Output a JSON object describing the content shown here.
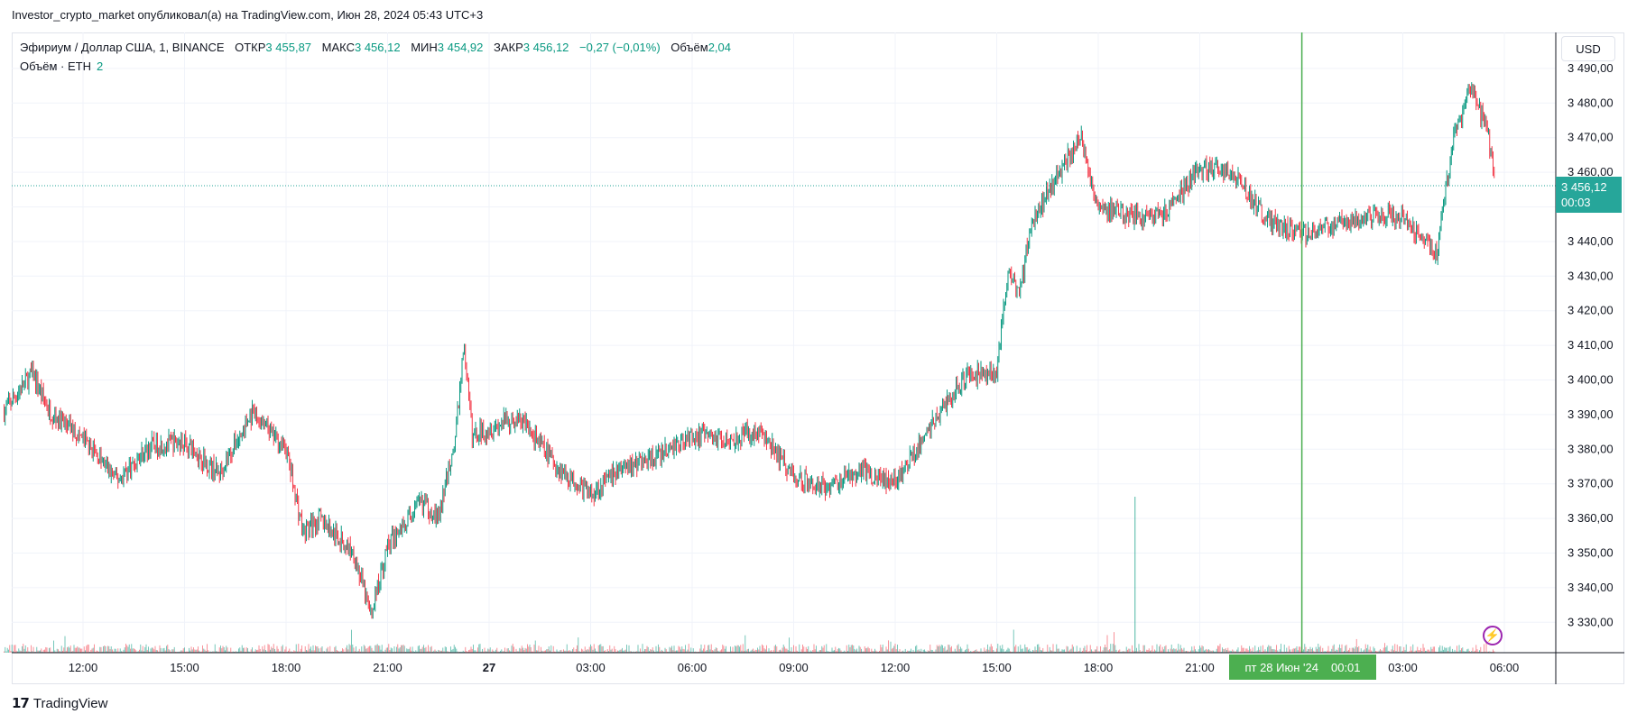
{
  "header": {
    "published_line": "Investor_crypto_market опубликовал(а) на TradingView.com, Июн 28, 2024 05:43 UTC+3"
  },
  "legend": {
    "symbol": "Эфириум / Доллар США, 1, BINANCE",
    "open_label": "ОТКР",
    "open_value": "3 455,87",
    "high_label": "МАКС",
    "high_value": "3 456,12",
    "low_label": "МИН",
    "low_value": "3 454,92",
    "close_label": "ЗАКР",
    "close_value": "3 456,12",
    "change": "−0,27 (−0,01%)",
    "volume_label": "Объём",
    "volume_value": "2,04",
    "volume_study": "Объём · ETH",
    "volume_study_value": "2"
  },
  "toolbar": {
    "currency": "USD"
  },
  "price_tag": {
    "price": "3 456,12",
    "countdown": "00:03"
  },
  "crosshair": {
    "date_day": "пт 28 Июн '24",
    "time": "00:01"
  },
  "footer": {
    "brand": "TradingView"
  },
  "colors": {
    "up": "#089981",
    "down": "#f23645",
    "last_price": "#26a69a",
    "crosshair": "#4caf50",
    "grid": "#f0f3fa"
  },
  "chart_data": {
    "type": "candlestick",
    "symbol": "ETHUSD",
    "interval": "1m",
    "x_ticks": [
      "12:00",
      "15:00",
      "18:00",
      "21:00",
      "27",
      "03:00",
      "06:00",
      "09:00",
      "12:00",
      "15:00",
      "18:00",
      "21:00",
      "28",
      "03:00",
      "06:00"
    ],
    "y_ticks": [
      3330,
      3340,
      3350,
      3360,
      3370,
      3380,
      3390,
      3400,
      3410,
      3420,
      3430,
      3440,
      3450,
      3460,
      3470,
      3480,
      3490
    ],
    "y_tick_labels": [
      "3 330,00",
      "3 340,00",
      "3 350,00",
      "3 360,00",
      "3 370,00",
      "3 380,00",
      "3 390,00",
      "3 400,00",
      "3 410,00",
      "3 420,00",
      "3 430,00",
      "3 440,00",
      "3 450,00",
      "3 460,00",
      "3 470,00",
      "3 480,00",
      "3 490,00"
    ],
    "ylim": [
      3322,
      3494
    ],
    "last_price": 3456.12,
    "crosshair_time": "28 Jun 00:01",
    "price_path": [
      {
        "t": "26 Jun 09:40",
        "p": 3391
      },
      {
        "t": "26 Jun 10:30",
        "p": 3402
      },
      {
        "t": "26 Jun 11:00",
        "p": 3391
      },
      {
        "t": "26 Jun 12:00",
        "p": 3383
      },
      {
        "t": "26 Jun 13:00",
        "p": 3371
      },
      {
        "t": "26 Jun 14:00",
        "p": 3381
      },
      {
        "t": "26 Jun 15:00",
        "p": 3382
      },
      {
        "t": "26 Jun 16:00",
        "p": 3373
      },
      {
        "t": "26 Jun 17:00",
        "p": 3390
      },
      {
        "t": "26 Jun 18:00",
        "p": 3380
      },
      {
        "t": "26 Jun 18:30",
        "p": 3356
      },
      {
        "t": "26 Jun 19:00",
        "p": 3360
      },
      {
        "t": "26 Jun 20:00",
        "p": 3350
      },
      {
        "t": "26 Jun 20:30",
        "p": 3332
      },
      {
        "t": "26 Jun 21:00",
        "p": 3352
      },
      {
        "t": "26 Jun 22:00",
        "p": 3365
      },
      {
        "t": "26 Jun 22:30",
        "p": 3360
      },
      {
        "t": "26 Jun 23:00",
        "p": 3383
      },
      {
        "t": "26 Jun 23:15",
        "p": 3410
      },
      {
        "t": "26 Jun 23:30",
        "p": 3384
      },
      {
        "t": "27 Jun 00:30",
        "p": 3388
      },
      {
        "t": "27 Jun 01:00",
        "p": 3388
      },
      {
        "t": "27 Jun 02:00",
        "p": 3375
      },
      {
        "t": "27 Jun 03:00",
        "p": 3367
      },
      {
        "t": "27 Jun 04:00",
        "p": 3375
      },
      {
        "t": "27 Jun 05:00",
        "p": 3378
      },
      {
        "t": "27 Jun 06:00",
        "p": 3384
      },
      {
        "t": "27 Jun 07:00",
        "p": 3383
      },
      {
        "t": "27 Jun 08:00",
        "p": 3385
      },
      {
        "t": "27 Jun 09:00",
        "p": 3372
      },
      {
        "t": "27 Jun 10:00",
        "p": 3369
      },
      {
        "t": "27 Jun 11:00",
        "p": 3374
      },
      {
        "t": "27 Jun 12:00",
        "p": 3370
      },
      {
        "t": "27 Jun 13:00",
        "p": 3386
      },
      {
        "t": "27 Jun 14:00",
        "p": 3400
      },
      {
        "t": "27 Jun 15:00",
        "p": 3403
      },
      {
        "t": "27 Jun 15:20",
        "p": 3431
      },
      {
        "t": "27 Jun 15:40",
        "p": 3424
      },
      {
        "t": "27 Jun 16:00",
        "p": 3445
      },
      {
        "t": "27 Jun 17:00",
        "p": 3463
      },
      {
        "t": "27 Jun 17:30",
        "p": 3470
      },
      {
        "t": "27 Jun 18:00",
        "p": 3450
      },
      {
        "t": "27 Jun 19:00",
        "p": 3447
      },
      {
        "t": "27 Jun 20:00",
        "p": 3448
      },
      {
        "t": "27 Jun 21:00",
        "p": 3461
      },
      {
        "t": "27 Jun 22:00",
        "p": 3460
      },
      {
        "t": "27 Jun 23:00",
        "p": 3446
      },
      {
        "t": "28 Jun 00:00",
        "p": 3442
      },
      {
        "t": "28 Jun 01:00",
        "p": 3445
      },
      {
        "t": "28 Jun 02:00",
        "p": 3448
      },
      {
        "t": "28 Jun 03:00",
        "p": 3447
      },
      {
        "t": "28 Jun 04:00",
        "p": 3437
      },
      {
        "t": "28 Jun 04:30",
        "p": 3470
      },
      {
        "t": "28 Jun 05:00",
        "p": 3484
      },
      {
        "t": "28 Jun 05:30",
        "p": 3472
      },
      {
        "t": "28 Jun 05:43",
        "p": 3456
      }
    ]
  }
}
